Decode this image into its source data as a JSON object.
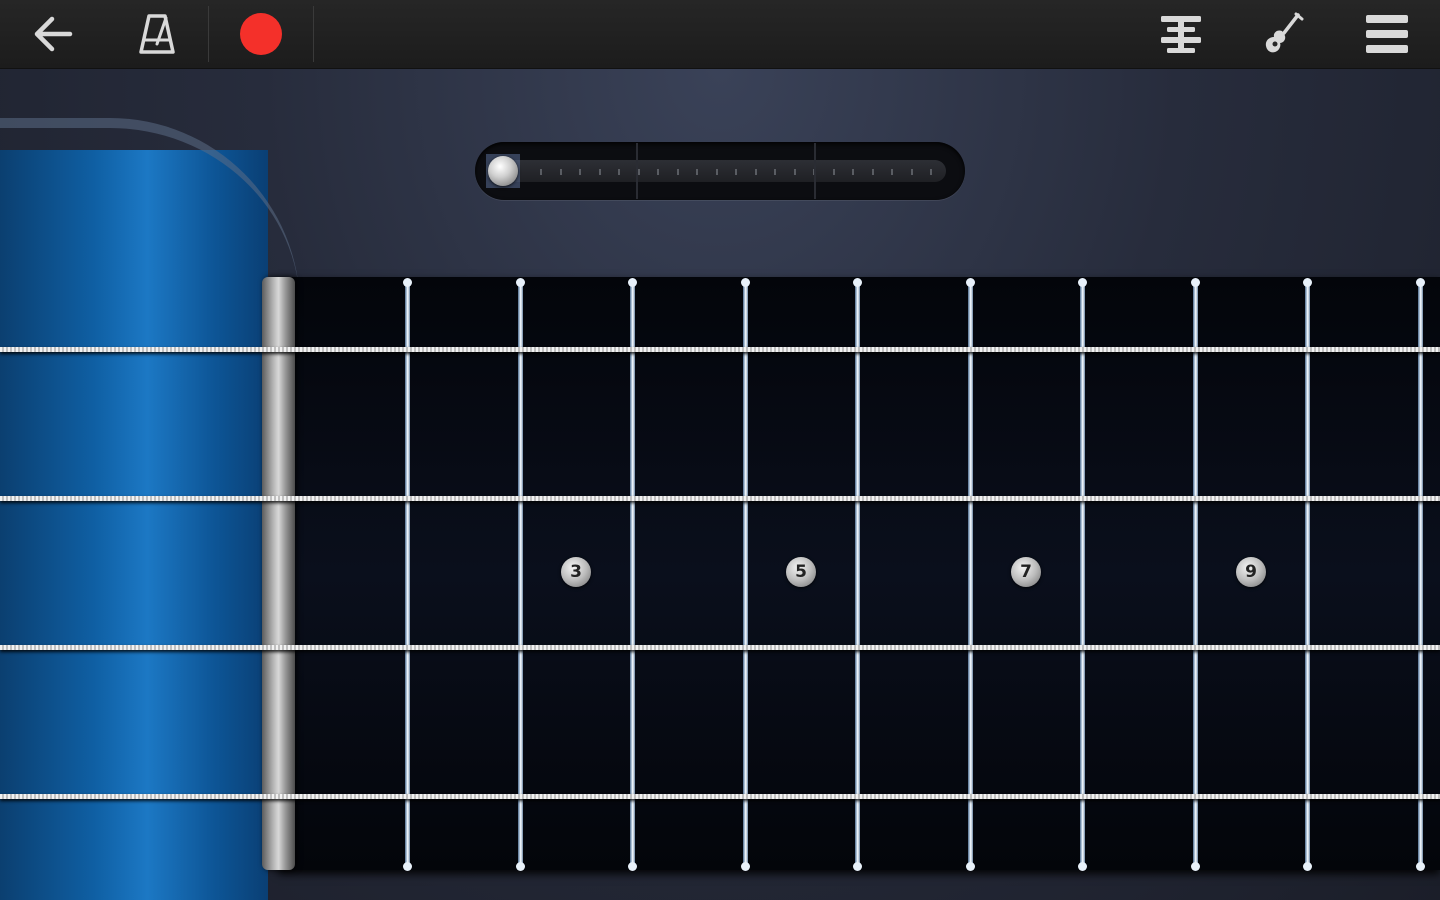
{
  "toolbar": {
    "left_icons": [
      "back-arrow-icon",
      "metronome-icon",
      "record-icon"
    ],
    "right_icons": [
      "chord-list-icon",
      "guitar-icon",
      "menu-icon"
    ],
    "record_color": "#f4302a"
  },
  "fretboard": {
    "inlays": [
      "3",
      "5",
      "7",
      "9"
    ],
    "string_count": 4,
    "fret_count": 10,
    "panel_color": "#0f5fa3"
  },
  "position_slider": {
    "value": 0
  }
}
